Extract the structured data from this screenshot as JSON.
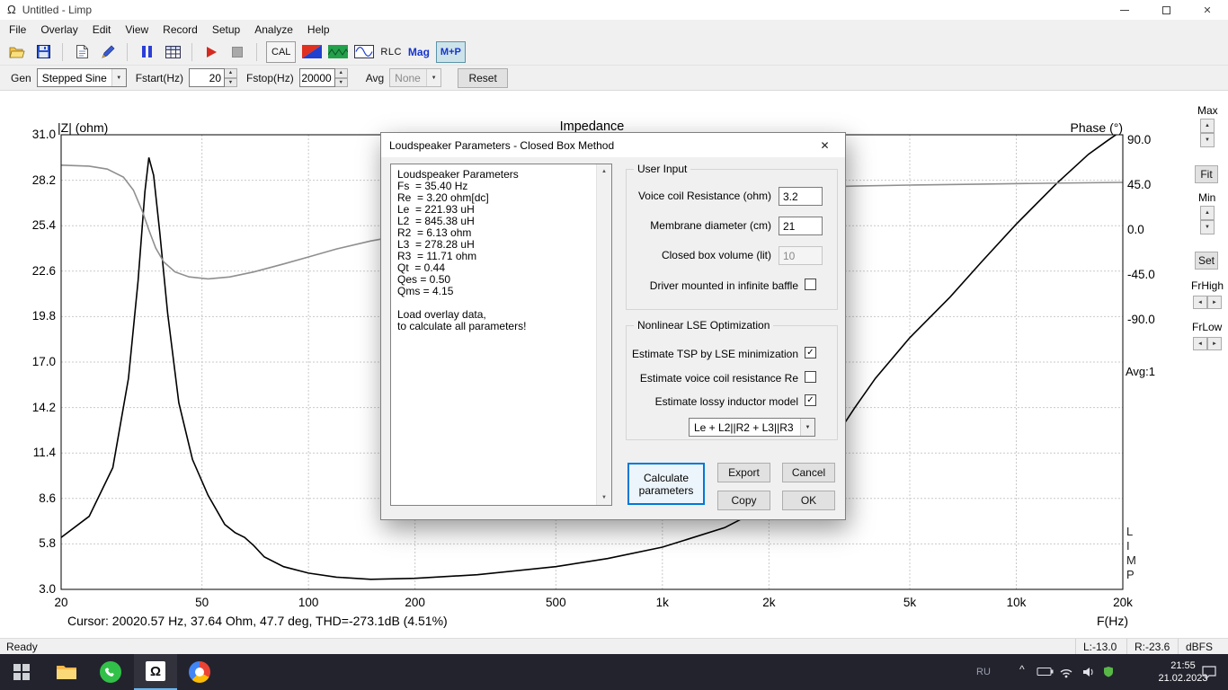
{
  "window": {
    "title": "Untitled - Limp"
  },
  "menu": {
    "items": [
      "File",
      "Overlay",
      "Edit",
      "View",
      "Record",
      "Setup",
      "Analyze",
      "Help"
    ]
  },
  "toolbar": {
    "cal": "CAL",
    "rlc": "RLC",
    "mag": "Mag",
    "mp": "M+P"
  },
  "parambar": {
    "gen_label": "Gen",
    "gen_value": "Stepped Sine",
    "fstart_label": "Fstart(Hz)",
    "fstart_value": "20",
    "fstop_label": "Fstop(Hz)",
    "fstop_value": "20000",
    "avg_label": "Avg",
    "avg_value": "None",
    "reset_label": "Reset"
  },
  "chart": {
    "title": "Impedance",
    "y_left_label": "|Z| (ohm)",
    "y_right_label": "Phase (°)",
    "x_label": "F(Hz)",
    "cursor_text": "Cursor: 20020.57 Hz, 37.64 Ohm, 47.7 deg, THD=-273.1dB (4.51%)",
    "z_ticks": [
      "31.0",
      "28.2",
      "25.4",
      "22.6",
      "19.8",
      "17.0",
      "14.2",
      "11.4",
      "8.6",
      "5.8",
      "3.0"
    ],
    "phase_ticks": [
      "90.0",
      "45.0",
      "0.0",
      "-45.0",
      "-90.0"
    ],
    "f_ticks": [
      "20",
      "50",
      "100",
      "200",
      "500",
      "1k",
      "2k",
      "5k",
      "10k",
      "20k"
    ]
  },
  "chart_data": {
    "type": "line",
    "title": "Impedance",
    "x_axis": {
      "label": "F(Hz)",
      "scale": "log",
      "min": 20,
      "max": 20000
    },
    "y_left_axis": {
      "label": "|Z| (ohm)",
      "min": 3.0,
      "max": 31.0
    },
    "y_right_axis": {
      "label": "Phase (°)",
      "ticks": [
        90,
        45,
        0,
        -45,
        -90
      ]
    },
    "series": [
      {
        "name": "Impedance",
        "axis": "left",
        "color": "#000000",
        "points": [
          [
            20,
            6.2
          ],
          [
            24,
            7.5
          ],
          [
            28,
            10.5
          ],
          [
            31,
            16
          ],
          [
            33,
            22
          ],
          [
            34.5,
            27.5
          ],
          [
            35.4,
            29.6
          ],
          [
            36.5,
            28.5
          ],
          [
            38,
            25
          ],
          [
            40,
            20
          ],
          [
            43,
            14.5
          ],
          [
            47,
            11
          ],
          [
            52,
            8.8
          ],
          [
            58,
            7.0
          ],
          [
            62,
            6.5
          ],
          [
            66,
            6.2
          ],
          [
            70,
            5.7
          ],
          [
            75,
            5.0
          ],
          [
            85,
            4.4
          ],
          [
            100,
            4.0
          ],
          [
            120,
            3.75
          ],
          [
            150,
            3.62
          ],
          [
            200,
            3.68
          ],
          [
            300,
            3.9
          ],
          [
            500,
            4.4
          ],
          [
            700,
            4.9
          ],
          [
            1000,
            5.6
          ],
          [
            1500,
            6.8
          ],
          [
            2000,
            8.2
          ],
          [
            2500,
            10
          ],
          [
            3000,
            12
          ],
          [
            3500,
            14.2
          ],
          [
            4000,
            16
          ],
          [
            5000,
            18.5
          ],
          [
            6500,
            21
          ],
          [
            8000,
            23.2
          ],
          [
            10000,
            25.5
          ],
          [
            13000,
            28
          ],
          [
            16000,
            29.8
          ],
          [
            18000,
            30.6
          ],
          [
            20000,
            31.3
          ]
        ]
      },
      {
        "name": "Phase",
        "axis": "right",
        "color": "#8f8f8f",
        "points": [
          [
            20,
            65
          ],
          [
            24,
            64
          ],
          [
            27,
            61
          ],
          [
            30,
            53
          ],
          [
            32,
            40
          ],
          [
            34,
            18
          ],
          [
            35.4,
            0
          ],
          [
            37,
            -18
          ],
          [
            39,
            -32
          ],
          [
            42,
            -42
          ],
          [
            46,
            -47
          ],
          [
            52,
            -49
          ],
          [
            60,
            -47
          ],
          [
            70,
            -42
          ],
          [
            85,
            -34
          ],
          [
            100,
            -27
          ],
          [
            120,
            -19
          ],
          [
            150,
            -11
          ],
          [
            200,
            -3
          ],
          [
            260,
            5
          ],
          [
            350,
            14
          ],
          [
            500,
            23
          ],
          [
            700,
            30
          ],
          [
            1000,
            35
          ],
          [
            1500,
            39
          ],
          [
            2200,
            42
          ],
          [
            3500,
            44
          ],
          [
            5000,
            45
          ],
          [
            8000,
            46
          ],
          [
            12000,
            46.8
          ],
          [
            20000,
            47.7
          ]
        ]
      }
    ]
  },
  "side_panel": {
    "max_label": "Max",
    "fit_label": "Fit",
    "min_label": "Min",
    "set_label": "Set",
    "frhigh_label": "FrHigh",
    "frlow_label": "FrLow",
    "avg_text": "Avg:1",
    "limp_vertical": "L\nI\nM\nP"
  },
  "dialog": {
    "title": "Loudspeaker Parameters - Closed Box Method",
    "results_text": "Loudspeaker Parameters\nFs  = 35.40 Hz\nRe  = 3.20 ohm[dc]\nLe  = 221.93 uH\nL2  = 845.38 uH\nR2  = 6.13 ohm\nL3  = 278.28 uH\nR3  = 11.71 ohm\nQt  = 0.44\nQes = 0.50\nQms = 4.15\n\nLoad overlay data,\nto calculate all parameters!",
    "user_input": {
      "legend": "User Input",
      "fields": [
        {
          "label": "Voice coil Resistance (ohm)",
          "value": "3.2",
          "enabled": true
        },
        {
          "label": "Membrane diameter (cm)",
          "value": "21",
          "enabled": true
        },
        {
          "label": "Closed box volume (lit)",
          "value": "10",
          "enabled": false
        }
      ],
      "baffle_label": "Driver mounted in infinite baffle",
      "baffle_checked": false
    },
    "lse": {
      "legend": "Nonlinear LSE Optimization",
      "checkboxes": [
        {
          "label": "Estimate TSP by LSE minimization",
          "checked": true
        },
        {
          "label": "Estimate voice coil resistance Re",
          "checked": false
        },
        {
          "label": "Estimate lossy inductor model",
          "checked": true
        }
      ],
      "model_select": "Le + L2||R2 + L3||R3"
    },
    "buttons": {
      "calculate": "Calculate parameters",
      "export": "Export",
      "cancel": "Cancel",
      "copy": "Copy",
      "ok": "OK"
    }
  },
  "status_bar": {
    "ready": "Ready",
    "l_value": "L:-13.0",
    "r_value": "R:-23.6",
    "unit": "dBFS"
  },
  "taskbar": {
    "lang": "RU",
    "time": "21:55",
    "date": "21.02.2023"
  },
  "colors": {
    "accent": "#0078d7",
    "impedance_curve": "#000000",
    "phase_curve": "#8f8f8f",
    "taskbar_bg": "#23232e"
  }
}
